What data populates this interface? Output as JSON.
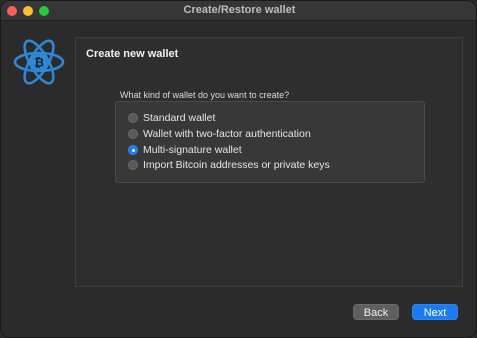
{
  "window": {
    "title": "Create/Restore wallet"
  },
  "panel": {
    "title": "Create new wallet",
    "question": "What kind of wallet do you want to create?",
    "options": [
      {
        "label": "Standard wallet",
        "checked": false
      },
      {
        "label": "Wallet with two-factor authentication",
        "checked": false
      },
      {
        "label": "Multi-signature wallet",
        "checked": true
      },
      {
        "label": "Import Bitcoin addresses or private keys",
        "checked": false
      }
    ]
  },
  "buttons": {
    "back": "Back",
    "next": "Next"
  },
  "icons": {
    "logo": "electrum-bitcoin-atom-logo"
  },
  "colors": {
    "accent": "#1a7cf5",
    "logo_blue": "#2d86d6",
    "close": "#fe5f57",
    "minimize": "#febc2e",
    "maximize": "#28c840"
  }
}
